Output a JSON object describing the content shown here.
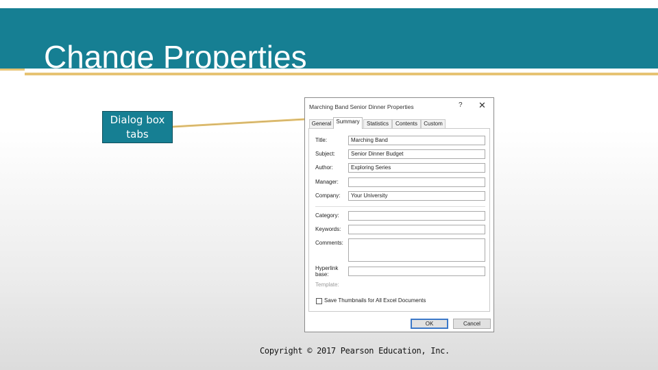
{
  "slide": {
    "title": "Change Properties",
    "callout": "Dialog box tabs",
    "copyright": "Copyright © 2017 Pearson Education, Inc."
  },
  "colors": {
    "title_band": "#167f93",
    "gold_rule": "#e6c373",
    "dialog_primary_border": "#3b78c8"
  },
  "dialog": {
    "title": "Marching Band Senior Dinner Properties",
    "help_icon": "?",
    "close_icon": "✕",
    "tabs": [
      "General",
      "Summary",
      "Statistics",
      "Contents",
      "Custom"
    ],
    "active_tab": "Summary",
    "fields": {
      "title": {
        "label": "Title:",
        "value": "Marching Band"
      },
      "subject": {
        "label": "Subject:",
        "value": "Senior Dinner Budget"
      },
      "author": {
        "label": "Author:",
        "value": "Exploring Series"
      },
      "manager": {
        "label": "Manager:",
        "value": ""
      },
      "company": {
        "label": "Company:",
        "value": "Your University"
      },
      "category": {
        "label": "Category:",
        "value": ""
      },
      "keywords": {
        "label": "Keywords:",
        "value": ""
      },
      "comments": {
        "label": "Comments:",
        "value": ""
      },
      "hyperlink_line1": "Hyperlink",
      "hyperlink_line2": "base:",
      "hyperlink_value": "",
      "template": "Template:"
    },
    "save_thumbnails": {
      "label": "Save Thumbnails for All Excel Documents",
      "checked": false
    },
    "ok_label": "OK",
    "cancel_label": "Cancel"
  }
}
